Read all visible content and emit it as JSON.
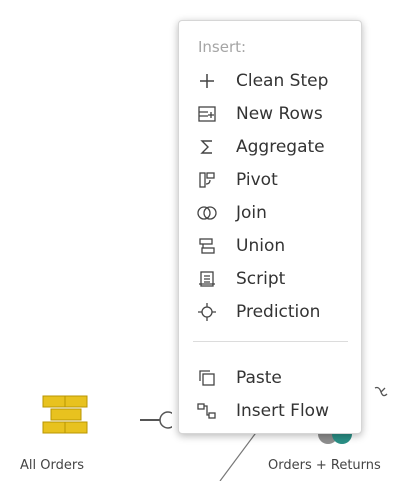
{
  "menu": {
    "header": "Insert:",
    "items": [
      {
        "label": "Clean Step",
        "icon": "plus-icon"
      },
      {
        "label": "New Rows",
        "icon": "new-rows-icon"
      },
      {
        "label": "Aggregate",
        "icon": "sigma-icon"
      },
      {
        "label": "Pivot",
        "icon": "pivot-icon"
      },
      {
        "label": "Join",
        "icon": "join-icon"
      },
      {
        "label": "Union",
        "icon": "union-icon"
      },
      {
        "label": "Script",
        "icon": "script-icon"
      },
      {
        "label": "Prediction",
        "icon": "prediction-icon"
      }
    ],
    "secondary_items": [
      {
        "label": "Paste",
        "icon": "paste-icon"
      },
      {
        "label": "Insert Flow",
        "icon": "insert-flow-icon"
      }
    ]
  },
  "flow": {
    "input_node_label": "All Orders",
    "join_node_label": "Orders + Returns"
  },
  "colors": {
    "input_node": "#e8c21f",
    "join_node_teal": "#2a8f86",
    "menu_text": "#333333",
    "menu_header": "#a5a5a5"
  }
}
